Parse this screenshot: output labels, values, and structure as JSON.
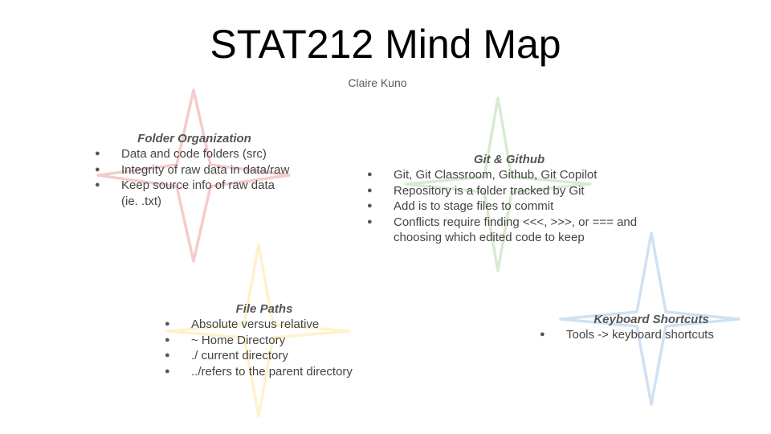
{
  "title": "STAT212 Mind Map",
  "author": "Claire Kuno",
  "colors": {
    "red_star": "#f4cccc",
    "green_star": "#d9ead3",
    "yellow_star": "#fff2cc",
    "blue_star": "#cfe2f3",
    "text": "#444444"
  },
  "nodes": [
    {
      "heading": "Folder Organization",
      "items": [
        "Data and code folders (src)",
        "Integrity of raw data in data/raw",
        "Keep source info of raw data (ie. .txt)"
      ]
    },
    {
      "heading": "Git & Github",
      "items": [
        "Git, Git Classroom, Github, Git Copilot",
        "Repository is a folder tracked by Git",
        "Add is to stage files to commit",
        "Conflicts require finding <<<, >>>, or === and choosing which edited code to keep"
      ]
    },
    {
      "heading": "File Paths",
      "items": [
        "Absolute versus relative",
        "~ Home Directory",
        "./ current directory",
        "../refers to the parent directory"
      ]
    },
    {
      "heading": "Keyboard Shortcuts",
      "items": [
        "Tools -> keyboard shortcuts"
      ]
    }
  ]
}
